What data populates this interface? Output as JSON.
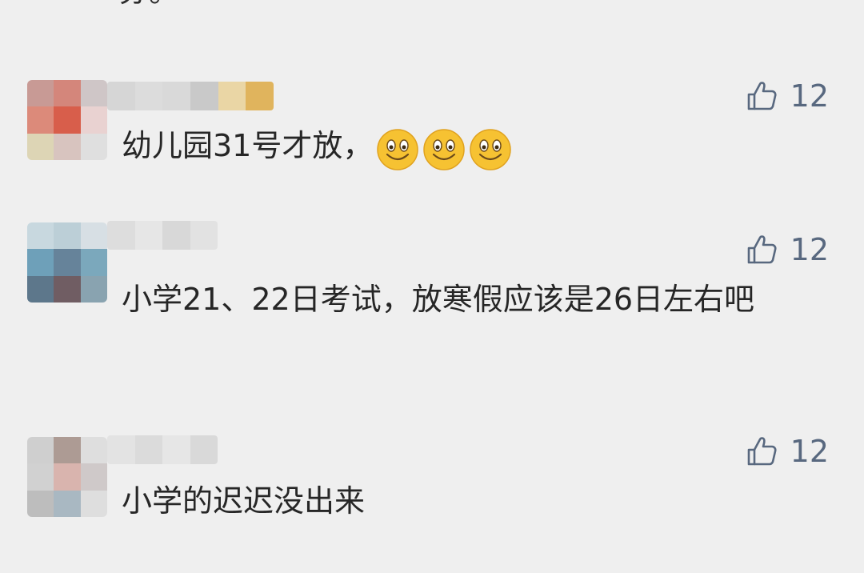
{
  "partial_text": "芬。",
  "comments": [
    {
      "text": "幼儿园31号才放，",
      "emoji": "grinning-face-emoji",
      "emoji_count": 3,
      "likes": "12",
      "avatar_colors": [
        "#c89a95",
        "#d4867b",
        "#cfc6c7",
        "#dc8a7a",
        "#d85e4b",
        "#e9d2d1",
        "#ddd5b5",
        "#d8c4bf",
        "#dfdfdf"
      ],
      "name_colors": [
        "#d6d6d6",
        "#dcdcdc",
        "#d9d9d9",
        "#c9c9c9",
        "#ead6a5",
        "#e0b45d"
      ]
    },
    {
      "text": "小学21、22日考试，放寒假应该是26日左右吧",
      "likes": "12",
      "avatar_colors": [
        "#c8d8df",
        "#bccfd7",
        "#d7dfe4",
        "#6ea0b9",
        "#66839a",
        "#7ba8bc",
        "#5d778b",
        "#705d63",
        "#89a3b0"
      ],
      "name_colors": [
        "#dddddd",
        "#e6e6e6",
        "#d8d8d8",
        "#e2e2e2"
      ]
    },
    {
      "text": "小学的迟迟没出来",
      "likes": "12",
      "avatar_colors": [
        "#cfcfcf",
        "#ad9b94",
        "#dedede",
        "#d1d1d1",
        "#d9b4ae",
        "#cfc9c9",
        "#bdbdbd",
        "#a9b8c2",
        "#dedede"
      ],
      "name_colors": [
        "#e3e3e3",
        "#dbdbdb",
        "#e6e6e6",
        "#d9d9d9"
      ]
    }
  ],
  "like_icon": "thumbs-up-icon",
  "like_color": "#58687f"
}
